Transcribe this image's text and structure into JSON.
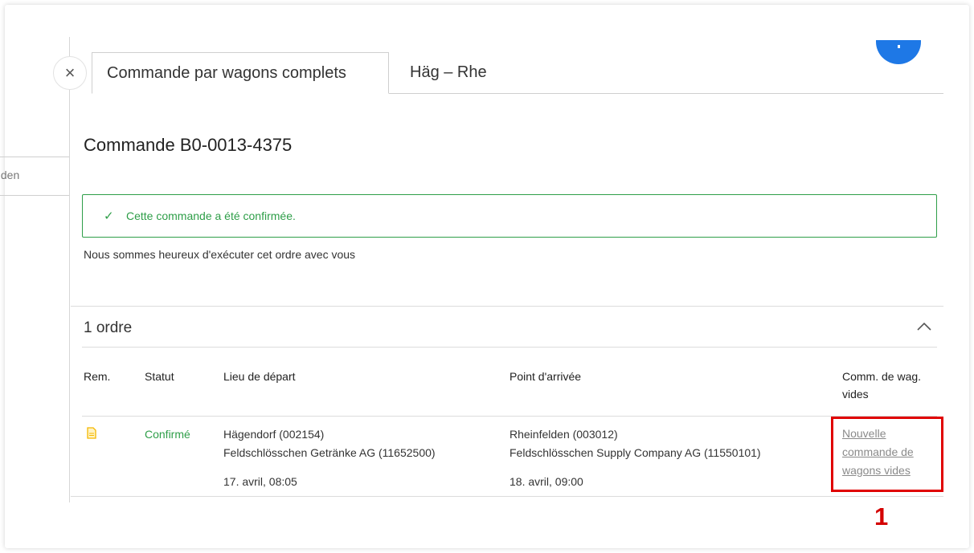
{
  "background_tab": {
    "label": "elden"
  },
  "tabs": [
    {
      "label": "Commande par wagons complets",
      "active": true
    },
    {
      "label": "Häg – Rhe",
      "active": false
    }
  ],
  "close_icon": "×",
  "order": {
    "title": "Commande B0-0013-4375",
    "success_message": "Cette commande a été confirmée.",
    "check_icon": "✓",
    "info_text": "Nous sommes heureux d'exécuter cet ordre avec vous"
  },
  "orders_section": {
    "count_label": "1 ordre",
    "chevron_icon": "^",
    "columns": {
      "rem": "Rem.",
      "statut": "Statut",
      "lieu_depart": "Lieu de départ",
      "point_arrivee": "Point d'arrivée",
      "comm_wag": "Comm. de wag. vides"
    },
    "rows": [
      {
        "rem_icon": "document-icon",
        "statut": "Confirmé",
        "depart_line1": "Hägendorf (002154)",
        "depart_line2": "Feldschlösschen Getränke AG (11652500)",
        "depart_time": "17. avril, 08:05",
        "arrivee_line1": "Rheinfelden (003012)",
        "arrivee_line2": "Feldschlösschen Supply Company AG (11550101)",
        "arrivee_time": "18. avril, 09:00",
        "link": "Nouvelle commande de wagons vides"
      }
    ]
  },
  "annotation": {
    "marker": "1"
  },
  "colors": {
    "success": "#2e9e48",
    "accent_blue": "#1e78e6",
    "highlight": "#e00000",
    "doc_icon": "#f5b800"
  }
}
